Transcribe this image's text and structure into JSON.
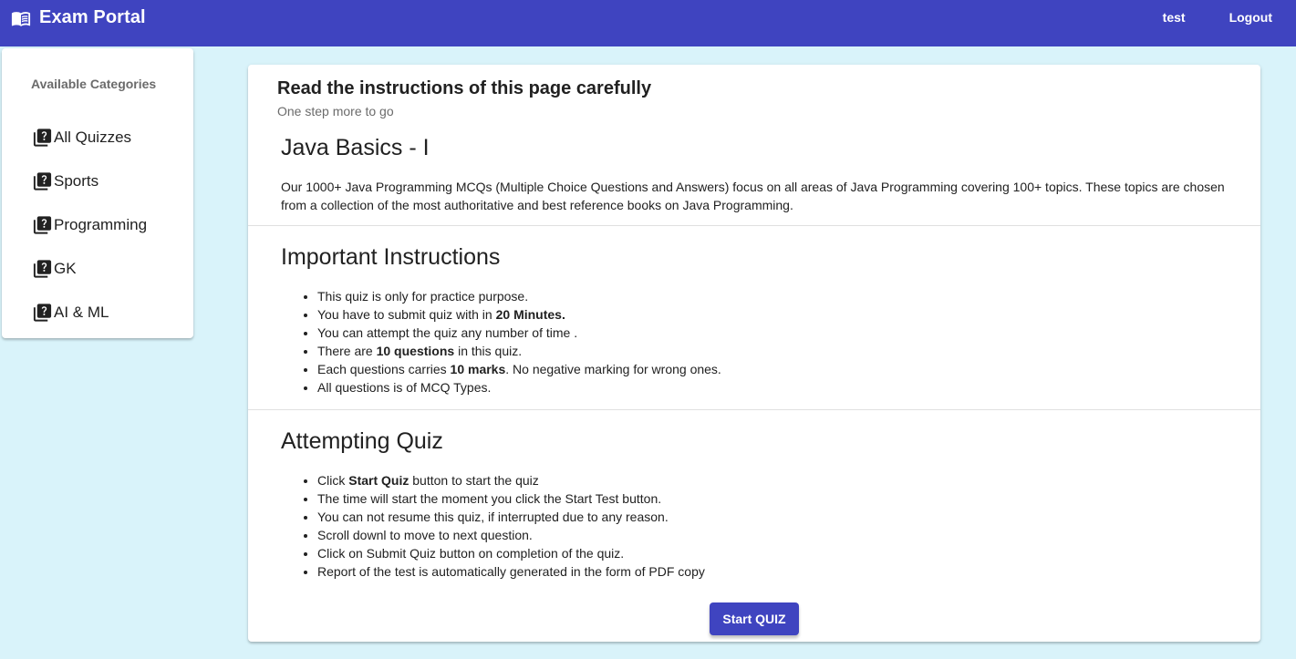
{
  "header": {
    "title": "Exam Portal",
    "user": "test",
    "logout": "Logout",
    "brand_icon": "menu-book-icon"
  },
  "sidebar": {
    "heading": "Available Categories",
    "item_icon": "quiz-icon",
    "items": [
      {
        "label": "All Quizzes"
      },
      {
        "label": "Sports"
      },
      {
        "label": "Programming"
      },
      {
        "label": "GK"
      },
      {
        "label": "AI & ML"
      }
    ]
  },
  "main": {
    "title": "Read the instructions of this page carefully",
    "subtitle": "One step more to go",
    "quiz_title": "Java Basics - I",
    "quiz_description": "Our 1000+ Java Programming MCQs (Multiple Choice Questions and Answers) focus on all areas of Java Programming covering 100+ topics. These topics are chosen from a collection of the most authoritative and best reference books on Java Programming.",
    "important": {
      "heading": "Important Instructions",
      "items": [
        {
          "pre": "This quiz is only for practice purpose.",
          "bold": "",
          "post": ""
        },
        {
          "pre": "You have to submit quiz with in ",
          "bold": "20 Minutes.",
          "post": ""
        },
        {
          "pre": "You can attempt the quiz any number of time .",
          "bold": "",
          "post": ""
        },
        {
          "pre": "There are ",
          "bold": "10 questions",
          "post": " in this quiz."
        },
        {
          "pre": "Each questions carries ",
          "bold": "10 marks",
          "post": ". No negative marking for wrong ones."
        },
        {
          "pre": "All questions is of MCQ Types.",
          "bold": "",
          "post": ""
        }
      ]
    },
    "attempting": {
      "heading": "Attempting Quiz",
      "items": [
        {
          "pre": "Click ",
          "bold": "Start Quiz",
          "post": " button to start the quiz"
        },
        {
          "pre": "The time will start the moment you click the Start Test button.",
          "bold": "",
          "post": ""
        },
        {
          "pre": "You can not resume this quiz, if interrupted due to any reason.",
          "bold": "",
          "post": ""
        },
        {
          "pre": "Scroll downl to move to next question.",
          "bold": "",
          "post": ""
        },
        {
          "pre": "Click on Submit Quiz button on completion of the quiz.",
          "bold": "",
          "post": ""
        },
        {
          "pre": "Report of the test is automatically generated in the form of PDF copy",
          "bold": "",
          "post": ""
        }
      ]
    },
    "start_button": "Start QUIZ"
  },
  "colors": {
    "primary": "#3f44c0",
    "background": "#d9f3fa",
    "card": "#ffffff",
    "muted_text": "#6b6b6b"
  }
}
